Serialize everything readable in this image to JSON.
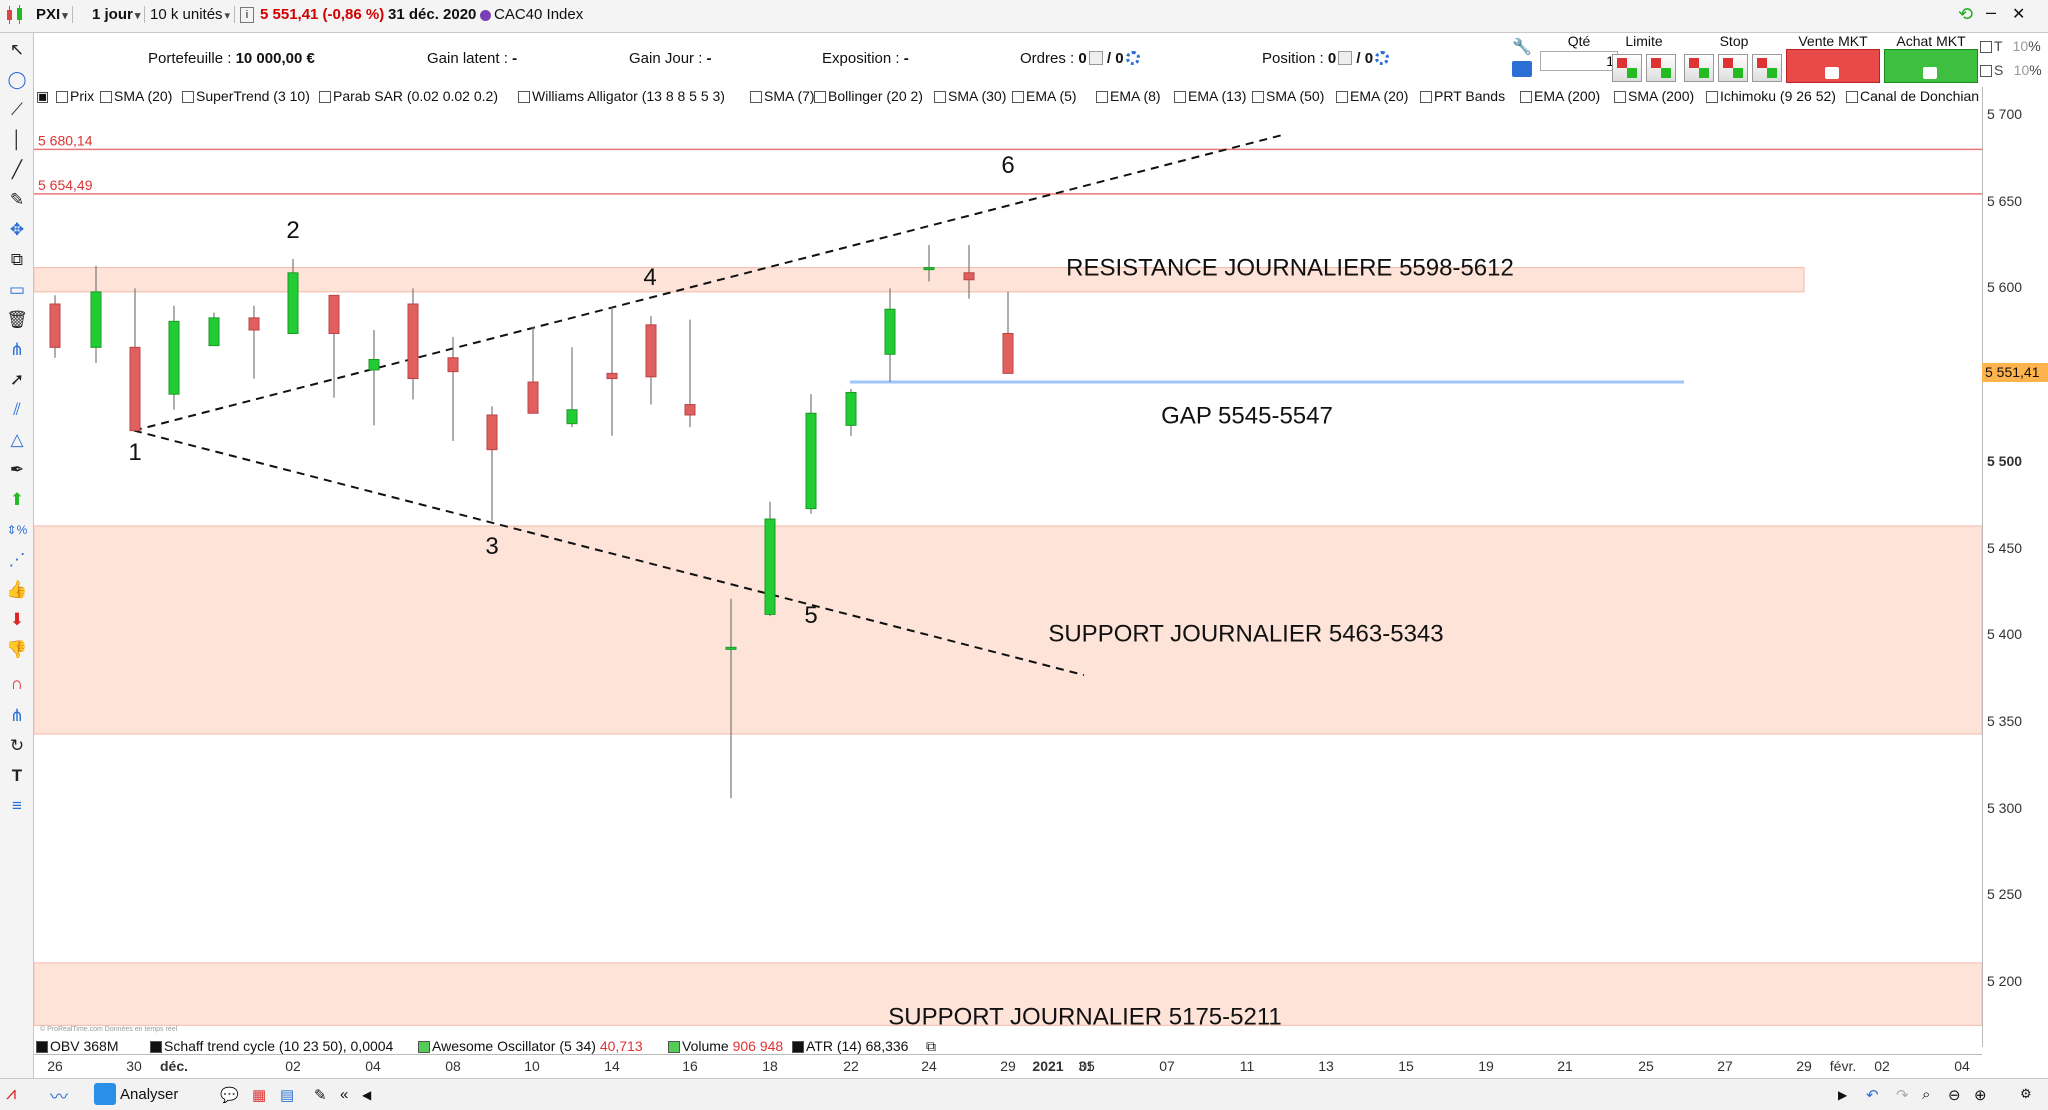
{
  "toolbar": {
    "symbol": "PXI",
    "period": "1 jour",
    "size": "10 k unités",
    "price_change": "5 551,41 (-0,86 %)",
    "date": "31 déc. 2020",
    "instrument": "CAC40 Index",
    "colors": {
      "price_change": "#d00000",
      "instrument_dot": "#7a3fb4"
    }
  },
  "portfolio": {
    "portefeuille_label": "Portefeuille :",
    "portefeuille_value": "10 000,00 €",
    "gain_latent_label": "Gain latent :",
    "gain_latent_value": "-",
    "gain_jour_label": "Gain Jour :",
    "gain_jour_value": "-",
    "exposition_label": "Exposition :",
    "exposition_value": "-",
    "ordres_label": "Ordres :",
    "ordres_value1": "0",
    "ordres_value2": "/ 0",
    "position_label": "Position :",
    "position_value1": "0",
    "position_value2": "/ 0"
  },
  "order_panel": {
    "qte_label": "Qté",
    "qte_value": "1",
    "limite_label": "Limite",
    "stop_label": "Stop",
    "vente_label": "Vente MKT",
    "achat_label": "Achat MKT",
    "t_label": "T",
    "t_value": "10",
    "t_unit": "%",
    "s_label": "S",
    "s_value": "10",
    "s_unit": "%"
  },
  "indicators": [
    "Prix",
    "SMA (20)",
    "SuperTrend (3 10)",
    "Parab SAR (0.02 0.02 0.2)",
    "Williams Alligator (13 8 8 5 5 3)",
    "SMA (7)",
    "Bollinger (20 2)",
    "SMA (30)",
    "EMA (5)",
    "EMA (8)",
    "EMA (13)",
    "SMA (50)",
    "EMA (20)",
    "PRT Bands",
    "EMA (200)",
    "SMA (200)",
    "Ichimoku (9 26 52)",
    "Canal de Donchian"
  ],
  "lower_indicators": {
    "obv": "OBV 368M",
    "schaff": "Schaff trend cycle (10 23 50)",
    "schaff_value": "0,0004",
    "awesome": "Awesome Oscillator (5 34)",
    "awesome_value": "40,713",
    "volume": "Volume",
    "volume_value": "906 948",
    "atr": "ATR (14)",
    "atr_value": "68,336"
  },
  "price_axis": {
    "ticks": [
      "5 700",
      "5 650",
      "5 600",
      "5 550",
      "5 500",
      "5 450",
      "5 400",
      "5 350",
      "5 300",
      "5 250",
      "5 200"
    ],
    "bold_tick": "5 500",
    "last_price": "5 551,41",
    "last_price_color": "#ffb34d"
  },
  "date_axis": [
    "26",
    "30",
    "déc.",
    "02",
    "04",
    "08",
    "10",
    "14",
    "16",
    "18",
    "22",
    "24",
    "29",
    "31",
    "2021",
    "05",
    "07",
    "11",
    "13",
    "15",
    "19",
    "21",
    "25",
    "27",
    "29",
    "févr.",
    "02",
    "04"
  ],
  "chart_data": {
    "type": "candlestick",
    "instrument": "CAC40 Index",
    "timeframe": "1 jour",
    "ylim": [
      5150,
      5720
    ],
    "candles": [
      {
        "date": "26 nov.",
        "open": 5591,
        "high": 5596,
        "low": 5560,
        "close": 5566
      },
      {
        "date": "27 nov.",
        "open": 5566,
        "high": 5613,
        "low": 5557,
        "close": 5598
      },
      {
        "date": "30 nov.",
        "open": 5566,
        "high": 5600,
        "low": 5518,
        "close": 5518
      },
      {
        "date": "01 déc.",
        "open": 5539,
        "high": 5590,
        "low": 5530,
        "close": 5581
      },
      {
        "date": "02 déc.",
        "open": 5567,
        "high": 5586,
        "low": 5567,
        "close": 5583
      },
      {
        "date": "03 déc.",
        "open": 5583,
        "high": 5590,
        "low": 5548,
        "close": 5576
      },
      {
        "date": "04 déc.",
        "open": 5574,
        "high": 5617,
        "low": 5574,
        "close": 5609
      },
      {
        "date": "07 déc.",
        "open": 5596,
        "high": 5596,
        "low": 5537,
        "close": 5574
      },
      {
        "date": "08 déc.",
        "open": 5553,
        "high": 5576,
        "low": 5521,
        "close": 5559
      },
      {
        "date": "09 déc.",
        "open": 5591,
        "high": 5600,
        "low": 5536,
        "close": 5548
      },
      {
        "date": "10 déc.",
        "open": 5560,
        "high": 5572,
        "low": 5512,
        "close": 5552
      },
      {
        "date": "11 déc.",
        "open": 5527,
        "high": 5532,
        "low": 5466,
        "close": 5507
      },
      {
        "date": "14 déc.",
        "open": 5546,
        "high": 5578,
        "low": 5528,
        "close": 5528
      },
      {
        "date": "15 déc.",
        "open": 5522,
        "high": 5566,
        "low": 5520,
        "close": 5530
      },
      {
        "date": "16 déc.",
        "open": 5551,
        "high": 5589,
        "low": 5515,
        "close": 5548
      },
      {
        "date": "17 déc.",
        "open": 5579,
        "high": 5584,
        "low": 5533,
        "close": 5549
      },
      {
        "date": "18 déc.",
        "open": 5533,
        "high": 5582,
        "low": 5520,
        "close": 5527
      },
      {
        "date": "21 déc.",
        "open": 5393,
        "high": 5421,
        "low": 5306,
        "close": 5393
      },
      {
        "date": "22 déc.",
        "open": 5412,
        "high": 5477,
        "low": 5411,
        "close": 5467
      },
      {
        "date": "23 déc.",
        "open": 5473,
        "high": 5539,
        "low": 5470,
        "close": 5528
      },
      {
        "date": "24 déc.",
        "open": 5521,
        "high": 5542,
        "low": 5515,
        "close": 5540
      },
      {
        "date": "28 déc.",
        "open": 5562,
        "high": 5600,
        "low": 5546,
        "close": 5588
      },
      {
        "date": "29 déc.",
        "open": 5611,
        "high": 5625,
        "low": 5604,
        "close": 5612
      },
      {
        "date": "30 déc.",
        "open": 5609,
        "high": 5625,
        "low": 5594,
        "close": 5605
      },
      {
        "date": "31 déc.",
        "open": 5574,
        "high": 5598,
        "low": 5551,
        "close": 5551
      }
    ],
    "horizontal_lines": [
      {
        "label": "5 680,14",
        "value": 5680.14
      },
      {
        "label": "5 654,49",
        "value": 5654.49
      }
    ],
    "zones": [
      {
        "label": "RESISTANCE JOURNALIERE 5598-5612",
        "low": 5598,
        "high": 5612
      },
      {
        "label": "SUPPORT JOURNALIER 5463-5343",
        "low": 5343,
        "high": 5463
      },
      {
        "label": "SUPPORT  JOURNALIER 5175-5211",
        "low": 5175,
        "high": 5211
      }
    ],
    "gap": {
      "label": "GAP 5545-5547",
      "low": 5545,
      "high": 5547
    },
    "wave_labels": [
      "1",
      "2",
      "3",
      "4",
      "5",
      "6"
    ],
    "colors": {
      "up": "#22cc33",
      "down": "#e06060",
      "zone": "#fde3d8",
      "level_line": "#e8787a",
      "gap_line": "#9fc4ff"
    }
  },
  "bottom_bar": {
    "analyser_label": "Analyser",
    "footer_note": "© ProRealTime.com  Données en temps réel"
  }
}
